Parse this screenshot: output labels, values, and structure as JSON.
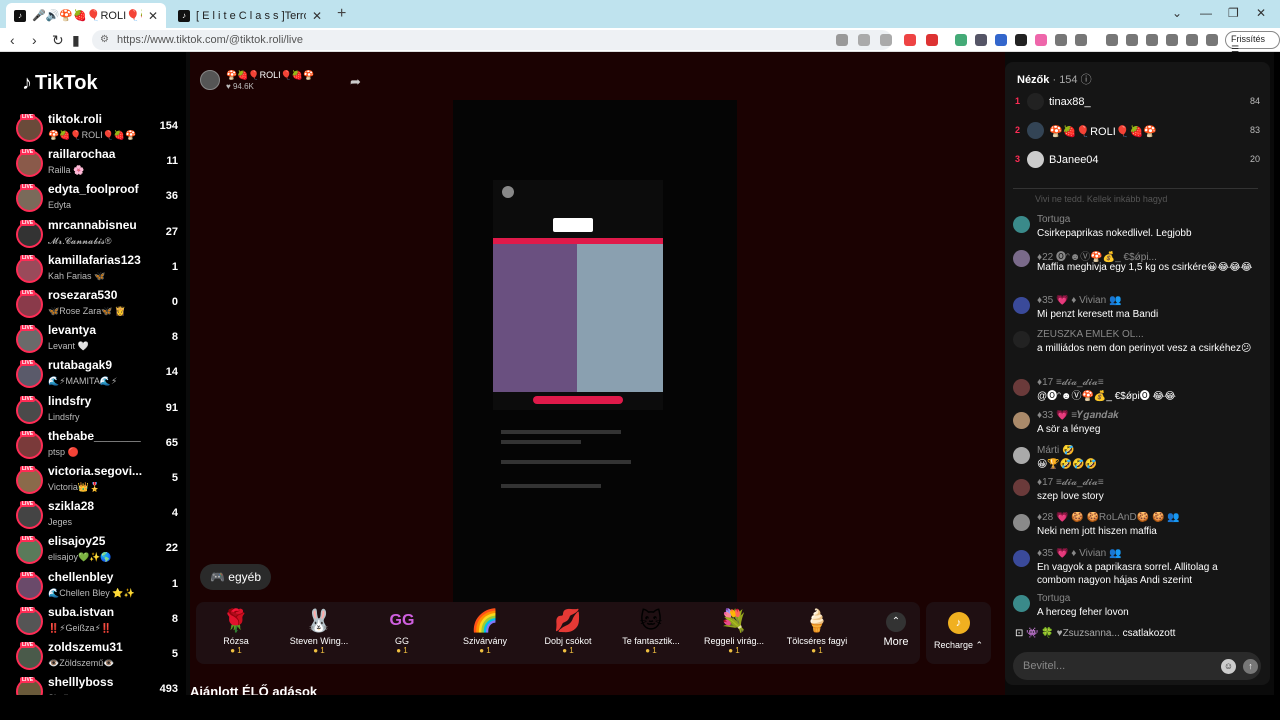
{
  "browser": {
    "tabs": [
      {
        "title": "🎤🔊🍄🍓🎈ROLI🎈🍓🍄(@tiktok.roli) is LIVE"
      },
      {
        "title": "[ E l i t e   C l a s s ]TerrorMe"
      }
    ],
    "url": "https://www.tiktok.com/@tiktok.roli/live",
    "refresh_label": "Frissítés"
  },
  "sidebar": {
    "logo": "TikTok",
    "live_label": "LIVE",
    "accounts": [
      {
        "user": "tiktok.roli",
        "name": "🍄🍓🎈ROLI🎈🍓🍄",
        "count": "154"
      },
      {
        "user": "raillarochaa",
        "name": "Railla 🌸",
        "count": "11"
      },
      {
        "user": "edyta_foolproof",
        "name": "Edyta",
        "count": "36"
      },
      {
        "user": "mrcannabisneu",
        "name": "𝓜𝓻.𝓒𝓪𝓷𝓷𝓪𝓫𝓲𝓼®",
        "count": "27"
      },
      {
        "user": "kamillafarias123",
        "name": "Kah Farias 🦋",
        "count": "1"
      },
      {
        "user": "rosezara530",
        "name": "🦋Rose Zara🦋 👸",
        "count": "0"
      },
      {
        "user": "levantya",
        "name": "Levant 🤍",
        "count": "8"
      },
      {
        "user": "rutabagak9",
        "name": "🌊⚡MAMITA🌊⚡",
        "count": "14"
      },
      {
        "user": "lindsfry",
        "name": "Lindsfry",
        "count": "91"
      },
      {
        "user": "thebabe_______",
        "name": "ptsp 🔴",
        "count": "65"
      },
      {
        "user": "victoria.segovi...",
        "name": "Victoria👑🎖️",
        "count": "5"
      },
      {
        "user": "szikla28",
        "name": "Jeges",
        "count": "4"
      },
      {
        "user": "elisajoy25",
        "name": "elisajoy💚✨🌎",
        "count": "22"
      },
      {
        "user": "chellenbley",
        "name": "🌊Chellen Bley ⭐✨",
        "count": "1"
      },
      {
        "user": "suba.istvan",
        "name": "‼️⚡Geißza⚡‼️",
        "count": "8"
      },
      {
        "user": "zoldszemu31",
        "name": "👁️Zöldszemű👁️",
        "count": "5"
      },
      {
        "user": "shelllyboss",
        "name": "Shelly",
        "count": "493"
      }
    ]
  },
  "stream": {
    "host_name": "🍄🍓🎈ROLI🎈🍓🍄",
    "host_likes": "♥ 94.6K",
    "other_label": "egyéb",
    "recommended": "Ajánlott ÉLŐ adások",
    "more_label": "More",
    "recharge_label": "Recharge ⌃",
    "gifts": [
      {
        "icon": "🌹",
        "name": "Rózsa",
        "price": "1"
      },
      {
        "icon": "🐰",
        "name": "Steven Wing...",
        "price": "1"
      },
      {
        "icon": "GG",
        "name": "GG",
        "price": "1"
      },
      {
        "icon": "🌈",
        "name": "Szivárvány",
        "price": "1"
      },
      {
        "icon": "💋",
        "name": "Dobj csókot",
        "price": "1"
      },
      {
        "icon": "🐱",
        "name": "Te fantasztik...",
        "price": "1"
      },
      {
        "icon": "💐",
        "name": "Reggeli virág...",
        "price": "1"
      },
      {
        "icon": "🍦",
        "name": "Tölcséres fagyi",
        "price": "1"
      }
    ]
  },
  "chat": {
    "viewers_label": "Nézők",
    "viewers_count": "· 154",
    "top_viewers": [
      {
        "rank": "1",
        "name": "tinax88_",
        "score": "84"
      },
      {
        "rank": "2",
        "name": "🍄🍓🎈ROLI🎈🍓🍄",
        "score": "83"
      },
      {
        "rank": "3",
        "name": "BJanee04",
        "score": "20"
      }
    ],
    "faded": "Vivi ne tedd. Kellek inkább hagyd",
    "messages": [
      {
        "user": "Tortuga",
        "text": "Csirkepaprikas nokedlivel. Legjobb"
      },
      {
        "user": "♦22 🅞ᵔ☻Ⓥ🍄💰_ €$ǿpi...",
        "text": "Maffia meghivja egy 1,5 kg os csirkére😀😂😂😂"
      },
      {
        "user": "♦35 💗 ♦ Vivian 👥",
        "text": "Mi penzt keresett ma Bandi"
      },
      {
        "user": "ZEUSZKA EMLÉK OL...",
        "text": "a milliádos nem don perinyot vesz a csirkéhez😕"
      },
      {
        "user": "♦17 ≡𝓭𝓲𝓪_𝓭𝓲𝓪≡",
        "text": "@🅞ᵔ☻Ⓥ🍄💰_ €$ǿpi🅞 😂😂"
      },
      {
        "user": "♦33 💗 ≡𝒀𝒈𝒂𝒏𝒅𝒂𝒌",
        "text": "A sör a lényeg"
      },
      {
        "user": "Márti 🤣",
        "text": "😀🏆🤣🤣🤣"
      },
      {
        "user": "♦17 ≡𝓭𝓲𝓪_𝓭𝓲𝓪≡",
        "text": "szep love story"
      },
      {
        "user": "♦28 💗 🍪 🍪RoLAnD🍪 🍪 👥",
        "text": "Neki nem jott hiszen maffia"
      },
      {
        "user": "♦35 💗 ♦ Vivian 👥",
        "text": "En vagyok a paprikasra sorrel. Allitolag a combom nagyon hájas Andi szerint"
      },
      {
        "user": "Tortuga",
        "text": "A herceg feher lovon"
      }
    ],
    "join_user": "👾 🍀 ♥Zsuzsanna...",
    "join_text": "csatlakozott",
    "input_placeholder": "Bevitel..."
  }
}
